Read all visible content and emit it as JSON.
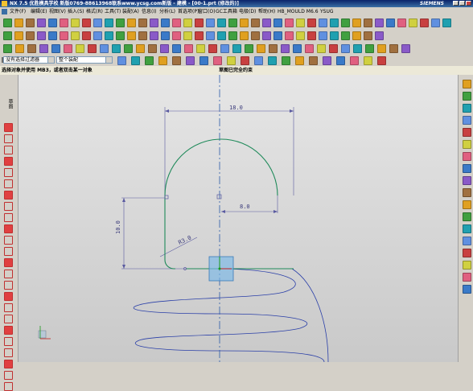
{
  "window": {
    "title": "NX 7.5 优胜模具学校 新版0769-88613968联系www.ycsg.com新版 - 建模 - [00-1.prt (修改的)]",
    "brand": "SIEMENS"
  },
  "menu": [
    "文件(F)",
    "编辑(E)",
    "视图(V)",
    "插入(S)",
    "格式(R)",
    "工具(T)",
    "装配(A)",
    "信息(I)",
    "分析(L)",
    "首选项(P)",
    "窗口(O)",
    "GC工具箱",
    "电极(D)",
    "帮助(H)",
    "HB_MOULD M6.6",
    "YSUG"
  ],
  "selection": {
    "filter": "没有选择过滤器",
    "assembly": "整个装配"
  },
  "status": {
    "prompt": "选择对象并使用 MB3，或者双击某一对象",
    "message": "草图已完全约束"
  },
  "left_toolbar_label": "草图",
  "sketch": {
    "dimensions": [
      "18.0",
      "8.0",
      "10.0",
      "R3.0"
    ]
  },
  "colors": {
    "curve": "#1f8a5a",
    "dimension": "#5a5aa0",
    "helix": "#2a3fa8",
    "center_line": "#2a5aa8"
  }
}
